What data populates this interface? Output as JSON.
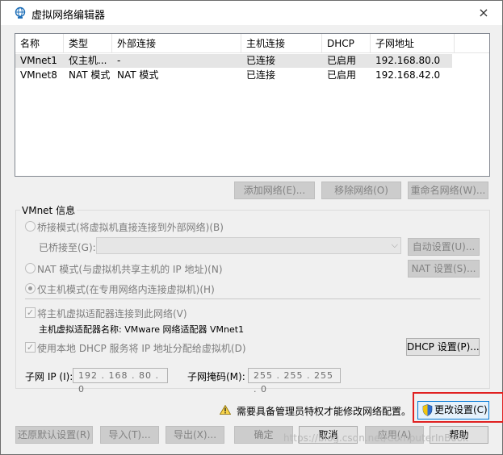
{
  "window": {
    "title": "虚拟网络编辑器",
    "close_label": "×"
  },
  "list": {
    "columns": [
      "名称",
      "类型",
      "外部连接",
      "主机连接",
      "DHCP",
      "子网地址"
    ],
    "rows": [
      [
        "VMnet1",
        "仅主机...",
        "-",
        "已连接",
        "已启用",
        "192.168.80.0"
      ],
      [
        "VMnet8",
        "NAT 模式",
        "NAT 模式",
        "已连接",
        "已启用",
        "192.168.42.0"
      ]
    ]
  },
  "list_buttons": {
    "add": "添加网络(E)...",
    "remove": "移除网络(O)",
    "rename": "重命名网络(W)..."
  },
  "vmnet_info": {
    "title": "VMnet 信息",
    "bridge_mode": "桥接模式(将虚拟机直接连接到外部网络)(B)",
    "bridged_to_label": "已桥接至(G):",
    "auto_settings": "自动设置(U)...",
    "nat_mode": "NAT 模式(与虚拟机共享主机的 IP 地址)(N)",
    "nat_settings": "NAT 设置(S)...",
    "host_only_mode": "仅主机模式(在专用网络内连接虚拟机)(H)",
    "connect_adapter": "将主机虚拟适配器连接到此网络(V)",
    "adapter_name": "主机虚拟适配器名称: VMware 网络适配器 VMnet1",
    "use_dhcp": "使用本地 DHCP 服务将 IP 地址分配给虚拟机(D)",
    "dhcp_settings": "DHCP 设置(P)...",
    "subnet_ip_label": "子网 IP (I):",
    "subnet_ip_value": "192 . 168 . 80 . 0",
    "subnet_mask_label": "子网掩码(M):",
    "subnet_mask_value": "255 . 255 . 255 . 0"
  },
  "admin": {
    "warning": "需要具备管理员特权才能修改网络配置。",
    "change_settings": "更改设置(C)"
  },
  "footer": {
    "restore": "还原默认设置(R)",
    "import": "导入(T)...",
    "export": "导出(X)...",
    "ok": "确定",
    "cancel": "取消",
    "apply": "应用(A)",
    "help": "帮助"
  },
  "watermark": "https://blog.csdn.net/ComputerInBook",
  "colors": {
    "highlight": "#e02020",
    "accent": "#1f5ea8"
  }
}
